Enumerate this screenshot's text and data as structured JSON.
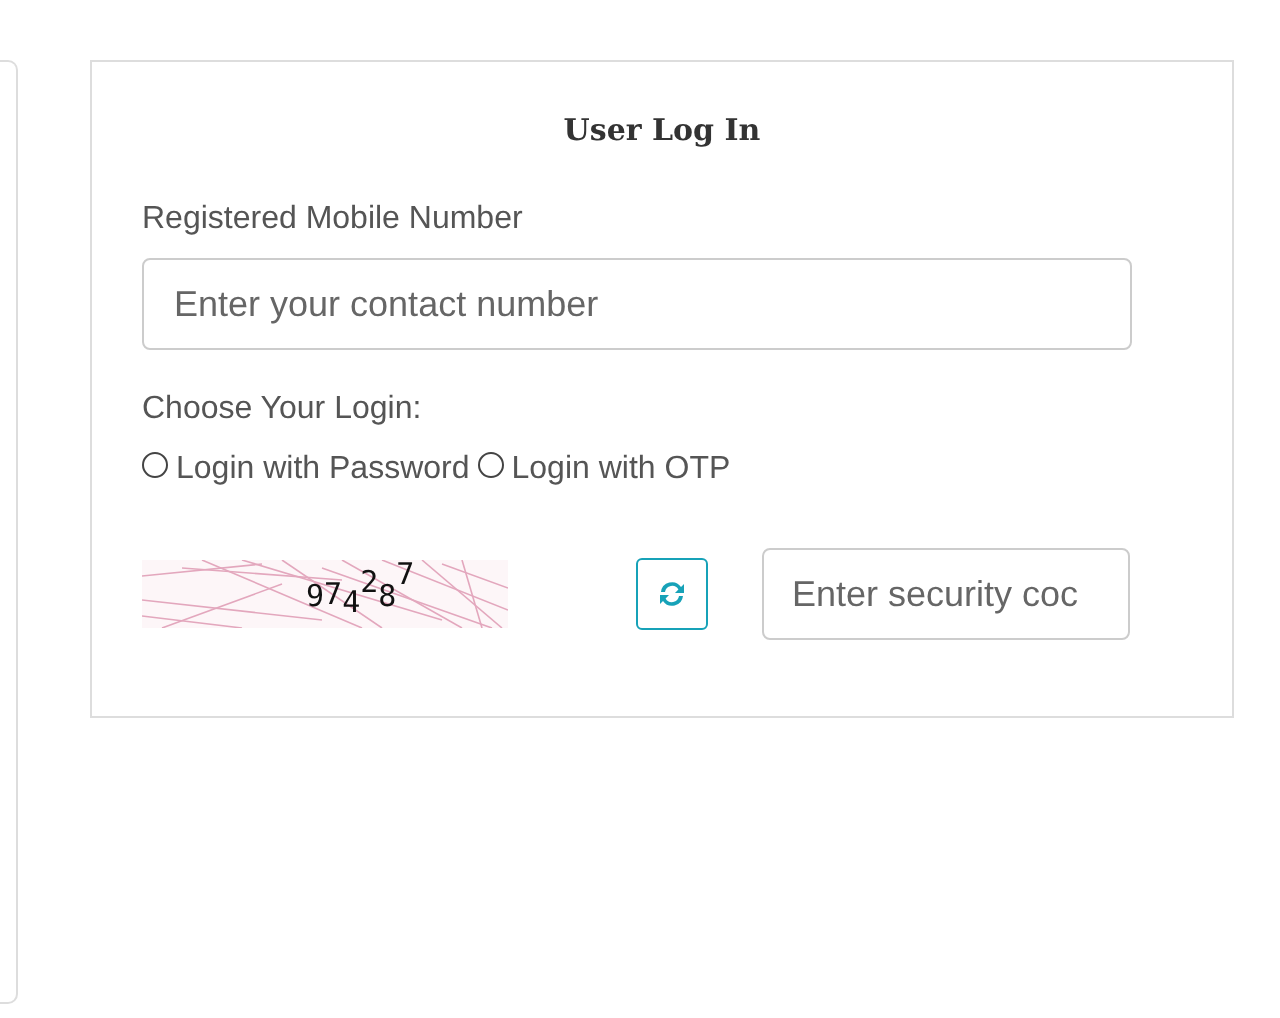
{
  "login_card": {
    "title": "User Log In",
    "mobile_label": "Registered Mobile Number",
    "mobile_field": {
      "placeholder": "Enter your contact number"
    },
    "login_choice_label": "Choose Your Login:",
    "login_options": [
      {
        "label": "Login with Password",
        "selected": false
      },
      {
        "label": "Login with OTP",
        "selected": false
      }
    ],
    "captcha": {
      "code": "974287"
    },
    "security_field": {
      "placeholder": "Enter security coc"
    }
  }
}
